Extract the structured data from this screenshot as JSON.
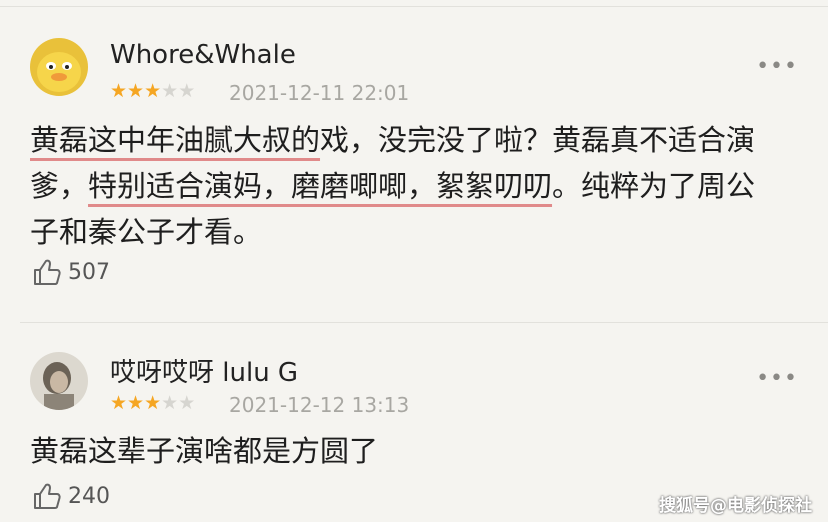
{
  "comments": [
    {
      "username": "Whore&Whale",
      "rating": 3,
      "timestamp": "2021-12-11 22:01",
      "lines": [
        {
          "parts": [
            {
              "text": "黄磊这中年油腻大叔的",
              "hl": true
            },
            {
              "text": "戏，没完没了啦？黄磊真不适合演",
              "hl": false
            }
          ]
        },
        {
          "parts": [
            {
              "text": "爹，",
              "hl": false
            },
            {
              "text": "特别适合演妈，磨磨唧唧，絮絮叨叨",
              "hl": true
            },
            {
              "text": "。纯粹为了周公",
              "hl": false
            }
          ]
        },
        {
          "parts": [
            {
              "text": "子和秦公子才看。",
              "hl": false
            }
          ]
        }
      ],
      "likes": "507",
      "more_label": "•••"
    },
    {
      "username": "哎呀哎呀 lulu G",
      "rating": 3,
      "timestamp": "2021-12-12 13:13",
      "lines": [
        {
          "parts": [
            {
              "text": "黄磊这辈子演啥都是方圆了",
              "hl": false
            }
          ]
        }
      ],
      "likes": "240",
      "more_label": "•••"
    }
  ],
  "watermark": "搜狐号@电影侦探社",
  "colors": {
    "star_on": "#f5a623",
    "star_off": "#d6d5d0",
    "underline": "#e08a8a"
  },
  "icons": {
    "like": "thumbs-up-icon",
    "more": "more-dots-icon",
    "star": "star-icon"
  }
}
